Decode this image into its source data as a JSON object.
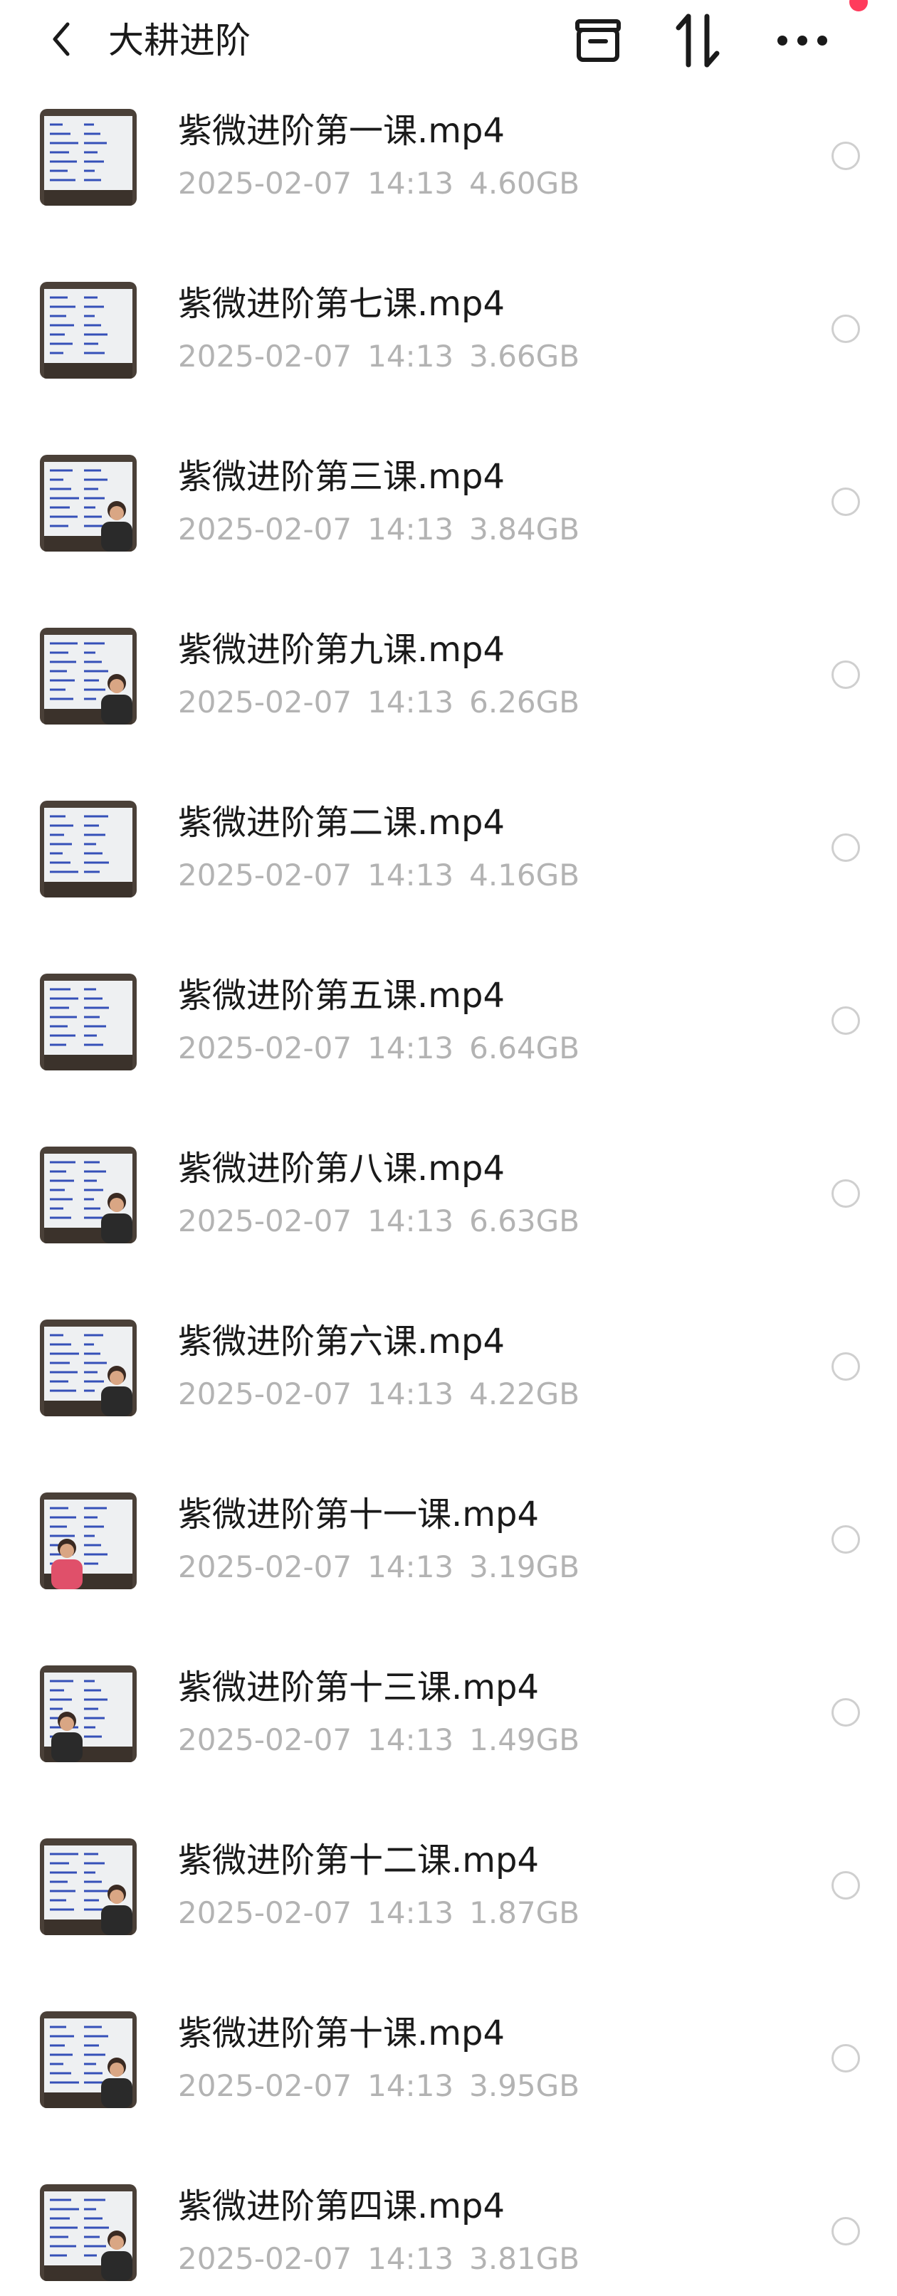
{
  "header": {
    "title": "大耕进阶",
    "icons": [
      "back-chevron-icon",
      "archive-box-icon",
      "sort-arrows-icon",
      "more-dots-icon"
    ],
    "accent_color": "#ff3b5c"
  },
  "files": [
    {
      "name": "紫微进阶第一课.mp4",
      "date": "2025-02-07",
      "time": "14:13",
      "size": "4.60GB"
    },
    {
      "name": "紫微进阶第七课.mp4",
      "date": "2025-02-07",
      "time": "14:13",
      "size": "3.66GB"
    },
    {
      "name": "紫微进阶第三课.mp4",
      "date": "2025-02-07",
      "time": "14:13",
      "size": "3.84GB"
    },
    {
      "name": "紫微进阶第九课.mp4",
      "date": "2025-02-07",
      "time": "14:13",
      "size": "6.26GB"
    },
    {
      "name": "紫微进阶第二课.mp4",
      "date": "2025-02-07",
      "time": "14:13",
      "size": "4.16GB"
    },
    {
      "name": "紫微进阶第五课.mp4",
      "date": "2025-02-07",
      "time": "14:13",
      "size": "6.64GB"
    },
    {
      "name": "紫微进阶第八课.mp4",
      "date": "2025-02-07",
      "time": "14:13",
      "size": "6.63GB"
    },
    {
      "name": "紫微进阶第六课.mp4",
      "date": "2025-02-07",
      "time": "14:13",
      "size": "4.22GB"
    },
    {
      "name": "紫微进阶第十一课.mp4",
      "date": "2025-02-07",
      "time": "14:13",
      "size": "3.19GB"
    },
    {
      "name": "紫微进阶第十三课.mp4",
      "date": "2025-02-07",
      "time": "14:13",
      "size": "1.49GB"
    },
    {
      "name": "紫微进阶第十二课.mp4",
      "date": "2025-02-07",
      "time": "14:13",
      "size": "1.87GB"
    },
    {
      "name": "紫微进阶第十课.mp4",
      "date": "2025-02-07",
      "time": "14:13",
      "size": "3.95GB"
    },
    {
      "name": "紫微进阶第四课.mp4",
      "date": "2025-02-07",
      "time": "14:13",
      "size": "3.81GB"
    }
  ]
}
